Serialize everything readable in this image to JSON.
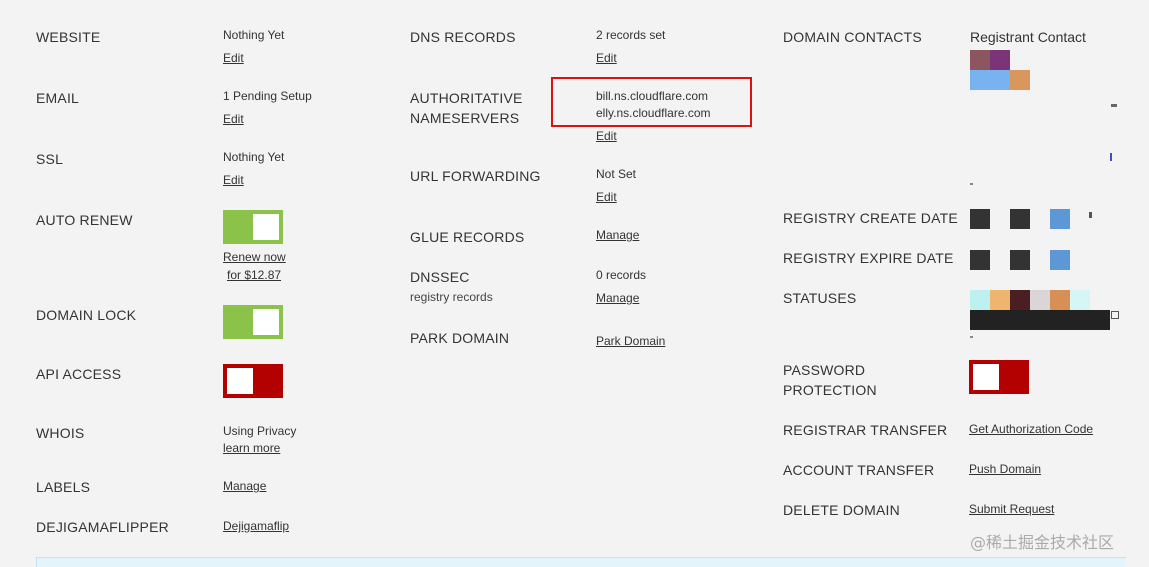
{
  "col1": {
    "website": {
      "label": "WEBSITE",
      "value": "Nothing Yet",
      "link": "Edit"
    },
    "email": {
      "label": "EMAIL",
      "value": "1 Pending Setup",
      "link": "Edit"
    },
    "ssl": {
      "label": "SSL",
      "value": "Nothing Yet",
      "link": "Edit"
    },
    "auto_renew": {
      "label": "AUTO RENEW",
      "state": "on",
      "link_line1": "Renew now",
      "link_line2": "for $12.87"
    },
    "domain_lock": {
      "label": "DOMAIN LOCK",
      "state": "on"
    },
    "api_access": {
      "label": "API ACCESS",
      "state": "off"
    },
    "whois": {
      "label": "WHOIS",
      "value": "Using Privacy",
      "link": "learn more"
    },
    "labels": {
      "label": "LABELS",
      "link": "Manage"
    },
    "dejigamaflipper": {
      "label": "DEJIGAMAFLIPPER",
      "link": "Dejigamaflip"
    }
  },
  "col2": {
    "dns_records": {
      "label": "DNS RECORDS",
      "value": "2 records set",
      "link": "Edit"
    },
    "nameservers": {
      "label_line1": "AUTHORITATIVE",
      "label_line2": "NAMESERVERS",
      "ns1": "bill.ns.cloudflare.com",
      "ns2": "elly.ns.cloudflare.com",
      "link": "Edit"
    },
    "url_forwarding": {
      "label": "URL FORWARDING",
      "value": "Not Set",
      "link": "Edit"
    },
    "glue_records": {
      "label": "GLUE RECORDS",
      "link": "Manage"
    },
    "dnssec": {
      "label": "DNSSEC",
      "sublabel": "registry records",
      "value": "0 records",
      "link": "Manage"
    },
    "park_domain": {
      "label": "PARK DOMAIN",
      "link": "Park Domain"
    }
  },
  "col3": {
    "domain_contacts": {
      "label": "DOMAIN CONTACTS",
      "value": "Registrant Contact"
    },
    "registry_create_date": {
      "label": "REGISTRY CREATE DATE"
    },
    "registry_expire_date": {
      "label": "REGISTRY EXPIRE DATE"
    },
    "statuses": {
      "label": "STATUSES"
    },
    "password_protection": {
      "label_line1": "PASSWORD",
      "label_line2": "PROTECTION",
      "state": "off"
    },
    "registrar_transfer": {
      "label": "REGISTRAR TRANSFER",
      "link": "Get Authorization Code"
    },
    "account_transfer": {
      "label": "ACCOUNT TRANSFER",
      "link": "Push Domain"
    },
    "delete_domain": {
      "label": "DELETE DOMAIN",
      "link": "Submit Request"
    }
  },
  "watermark": "@稀土掘金技术社区",
  "colors": {
    "toggle_on": "#8bc34a",
    "toggle_off": "#b30000",
    "highlight_border": "#dd1111"
  }
}
